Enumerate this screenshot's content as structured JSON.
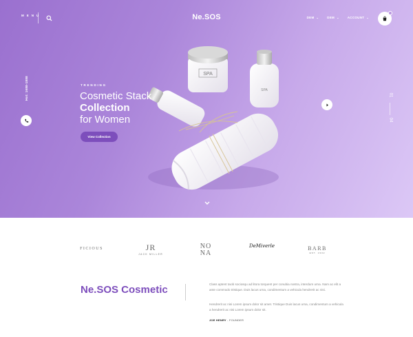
{
  "header": {
    "menu_label": "MENU",
    "logo": "Ne.SOS",
    "nav": [
      {
        "label": "DEM"
      },
      {
        "label": "DEM"
      },
      {
        "label": "ACCOUNT"
      }
    ]
  },
  "sidebar": {
    "phone": "Hot: 1688-1888"
  },
  "hero": {
    "eyebrow": "TRENDING",
    "line1": "Cosmetic Stack",
    "line2": "Collection",
    "line3": "for Women",
    "cta": "View Collection",
    "slide_current": "01",
    "slide_total": "04",
    "product_jar_label": "SPA",
    "product_bottle_label": "SPA"
  },
  "brands": [
    {
      "name": "FICIOUS"
    },
    {
      "name": "JR",
      "sub": "JACK MILLER"
    },
    {
      "name": "NO NA"
    },
    {
      "name": "DeMiverle"
    },
    {
      "name": "BARB",
      "sub": "EST. 1902"
    }
  ],
  "about": {
    "title": "Ne.SOS Cosmetic",
    "para1": "Class aptent taciti sociosqu ad litora torquent per conubia nostra, interdum urna. Nam ac elit a ante commodo tristique. Duis lacus urna, condimentum a vehicula hendrerit ac nisi.",
    "para2": "Hendrerit ac nisi Lorem ipsum dolor sit amet. Tristique Duis lacus urna, condimentum a vehicula a hendrerit ac nisi Lorem ipsum dolor sit.",
    "signature_name": "JOE HENRY",
    "signature_role": "- FOUNDER"
  },
  "colors": {
    "accent": "#7d4ebc",
    "hero_start": "#9a70cf",
    "hero_end": "#dcc8f6"
  }
}
